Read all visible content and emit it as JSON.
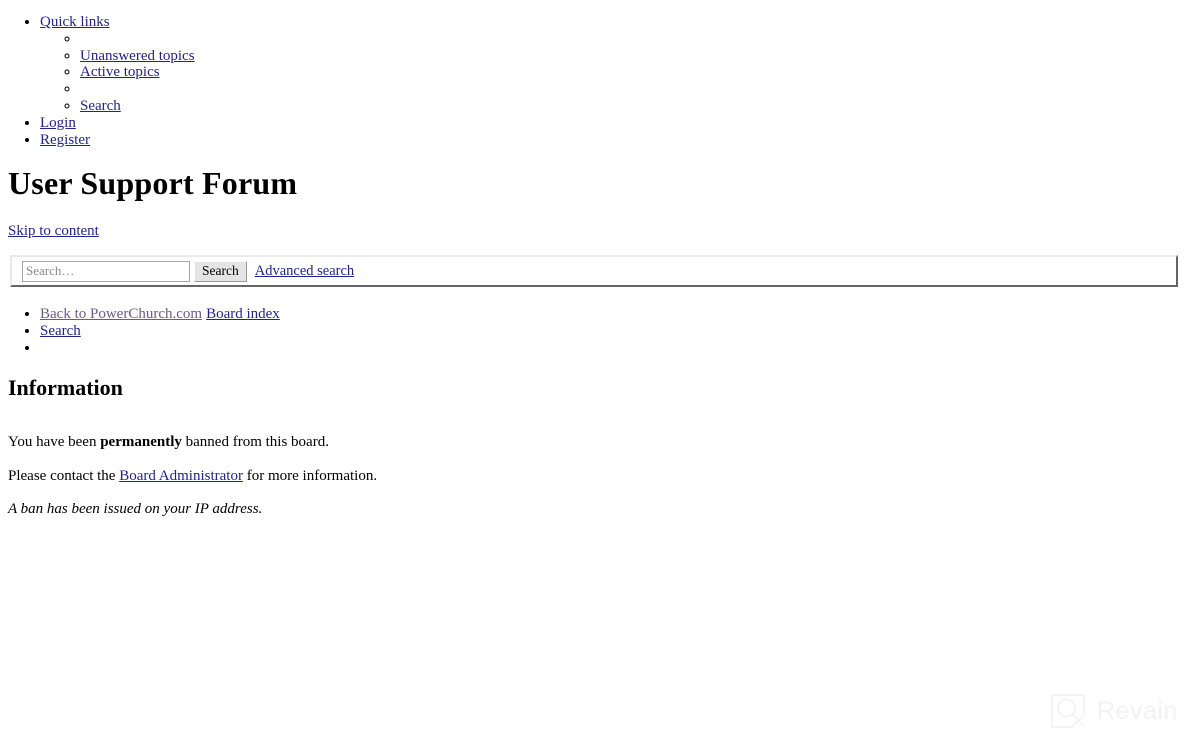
{
  "nav": {
    "quick_links_label": "Quick links",
    "sub_items": [
      {
        "label": "",
        "empty": true
      },
      {
        "label": "Unanswered topics",
        "empty": false
      },
      {
        "label": "Active topics",
        "empty": false
      },
      {
        "label": "",
        "empty": true
      },
      {
        "label": "Search",
        "empty": false
      }
    ],
    "login_label": "Login",
    "register_label": "Register"
  },
  "header": {
    "site_title": "User Support Forum",
    "skip_link": "Skip to content"
  },
  "search": {
    "value": "",
    "placeholder": "Search…",
    "button_label": "Search",
    "advanced_label": "Advanced search"
  },
  "breadcrumb": {
    "back_link": "Back to PowerChurch.com",
    "board_index": "Board index",
    "search_link": "Search",
    "empty_item": ""
  },
  "information": {
    "heading": "Information",
    "ban_prefix": "You have been ",
    "ban_emphasis": "permanently",
    "ban_suffix": " banned from this board.",
    "contact_prefix": "Please contact the ",
    "contact_link": "Board Administrator",
    "contact_suffix": " for more information.",
    "ip_notice": "A ban has been issued on your IP address."
  },
  "watermark": {
    "text": "Revain",
    "icon": "revain-magnifier-logo",
    "color": "#f2f2f2"
  },
  "colors": {
    "link": "#23238e",
    "visited_link": "#6b5b86",
    "text": "#000000",
    "background": "#ffffff"
  }
}
